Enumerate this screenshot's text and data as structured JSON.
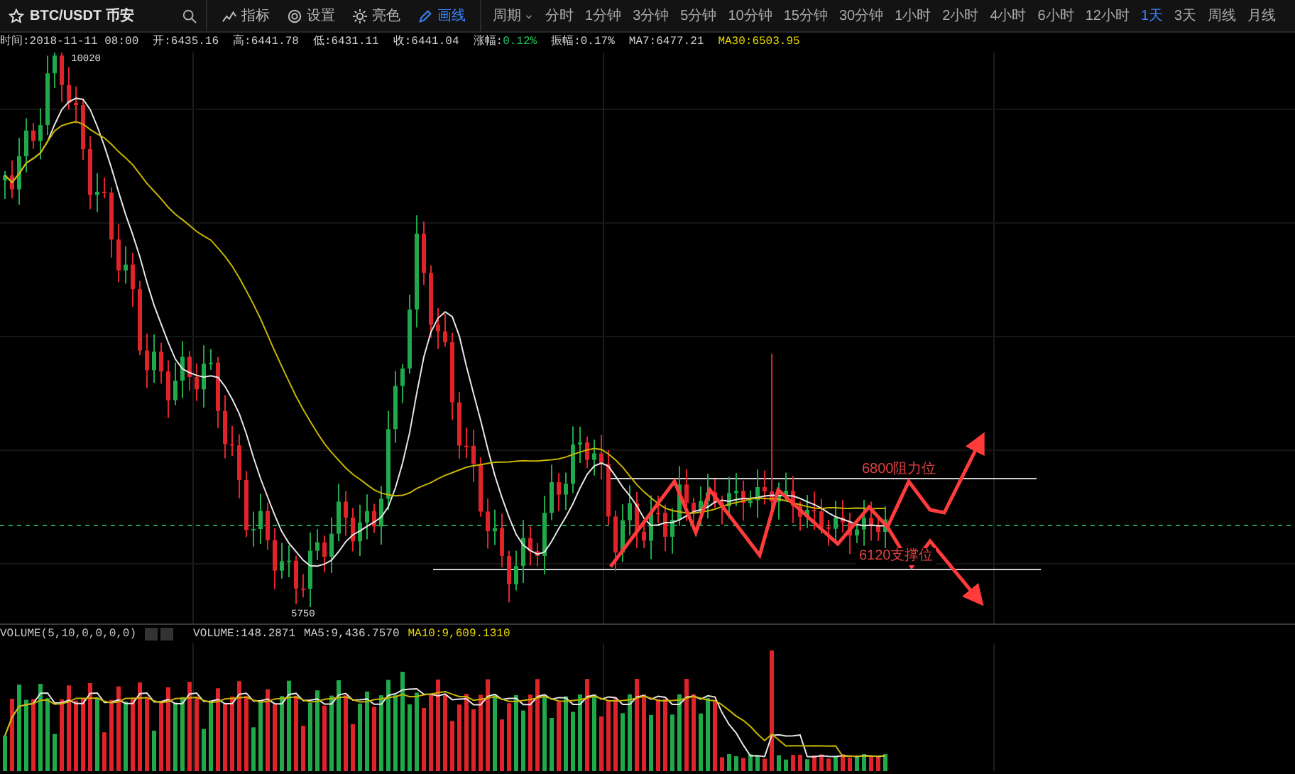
{
  "toolbar": {
    "symbol": "BTC/USDT 币安",
    "tools": [
      {
        "label": "指标",
        "selected": false
      },
      {
        "label": "设置",
        "selected": false
      },
      {
        "label": "亮色",
        "selected": false
      },
      {
        "label": "画线",
        "selected": true
      }
    ],
    "period_label": "周期",
    "intervals": [
      {
        "label": "分时",
        "selected": false
      },
      {
        "label": "1分钟",
        "selected": false
      },
      {
        "label": "3分钟",
        "selected": false
      },
      {
        "label": "5分钟",
        "selected": false
      },
      {
        "label": "10分钟",
        "selected": false
      },
      {
        "label": "15分钟",
        "selected": false
      },
      {
        "label": "30分钟",
        "selected": false
      },
      {
        "label": "1小时",
        "selected": false
      },
      {
        "label": "2小时",
        "selected": false
      },
      {
        "label": "4小时",
        "selected": false
      },
      {
        "label": "6小时",
        "selected": false
      },
      {
        "label": "12小时",
        "selected": false
      },
      {
        "label": "1天",
        "selected": true
      },
      {
        "label": "3天",
        "selected": false
      },
      {
        "label": "周线",
        "selected": false
      },
      {
        "label": "月线",
        "selected": false
      }
    ]
  },
  "info": [
    {
      "text": "时间:2018-11-11 08:00",
      "color": "#d0d0d0"
    },
    {
      "text": "开:6435.16",
      "color": "#d0d0d0"
    },
    {
      "text": "高:6441.78",
      "color": "#d0d0d0"
    },
    {
      "text": "低:6431.11",
      "color": "#d0d0d0"
    },
    {
      "text": "收:6441.04",
      "color": "#d0d0d0"
    },
    {
      "text": "涨幅:",
      "color": "#d0d0d0"
    },
    {
      "text": "0.12%",
      "color": "#22c55e"
    },
    {
      "text": "振幅:0.17%",
      "color": "#d0d0d0"
    },
    {
      "text": "MA7:6477.21",
      "color": "#d0d0d0"
    },
    {
      "text": "MA30:6503.95",
      "color": "#e8d800"
    }
  ],
  "chart": {
    "high_label": "10020",
    "low_label": "5750",
    "resistance_label": "6800阻力位",
    "support_label": "6120支撑位"
  },
  "volume": {
    "title": "VOLUME(5,10,0,0,0,0)",
    "readings": [
      {
        "text": "VOLUME:148.2871",
        "color": "#d0d0d0"
      },
      {
        "text": "MA5:9,436.7570",
        "color": "#d0d0d0"
      },
      {
        "text": "MA10:9,609.1310",
        "color": "#e8d800"
      }
    ]
  }
}
